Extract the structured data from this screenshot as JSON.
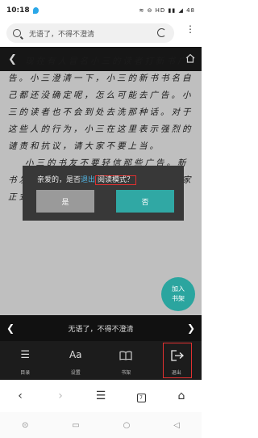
{
  "status_bar": {
    "time": "10:18",
    "right_indicators": "≋ ⊖ HD ▮▮ ◢ 48"
  },
  "search": {
    "query": "无语了，不得不澄清"
  },
  "article": {
    "paragraphs": [
      "现在有人冒名小三的读者打新书广告。小三澄清一下，小三的新书书名自己都还没确定呢，怎么可能去广告。小三的读者也不会到处去洗那种话。对于这些人的行为，小三在这里表示强烈的谴责和抗议，请大家不要上当。",
      "小三的书友不要轻信那些广告。新书发布的时候，小三会在书里面向大家正式发布的。谢谢。"
    ]
  },
  "dialog": {
    "message_prefix": "亲爱的，是否",
    "message_action": "退出",
    "message_mode": "阅读模式",
    "message_suffix": "？",
    "no_label": "是",
    "yes_label": "否"
  },
  "fab": {
    "line1": "加入",
    "line2": "书架"
  },
  "chapter_bar": {
    "title": "无语了，不得不澄清"
  },
  "toolbar": {
    "items": [
      {
        "label": "目录",
        "icon": "list-icon"
      },
      {
        "label": "设置",
        "icon": "font-settings-icon"
      },
      {
        "label": "书架",
        "icon": "book-icon"
      },
      {
        "label": "退出",
        "icon": "exit-icon"
      }
    ]
  },
  "browser_nav": {
    "tab_count": "7"
  }
}
